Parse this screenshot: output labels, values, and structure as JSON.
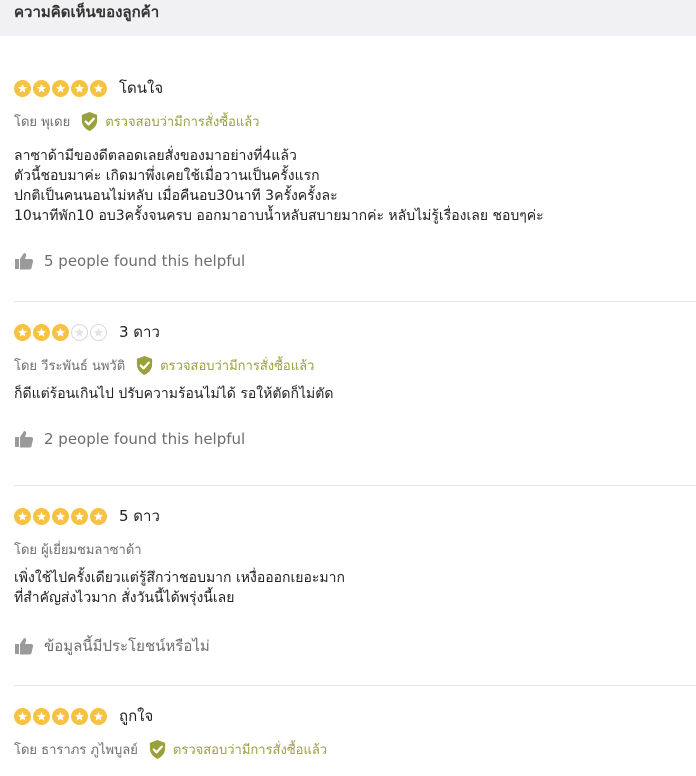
{
  "header": {
    "title": "ความคิดเห็นของลูกค้า"
  },
  "reviews": [
    {
      "stars": 5,
      "title": "โดนใจ",
      "author": "โดย พุเดย",
      "verified": "ตรวจสอบว่ามีการสั่งซื้อแล้ว",
      "body": [
        "ลาซาด้ามีของดีตลอดเลยสั่งของมาอย่างที่4แล้ว",
        "ตัวนี้ชอบมาค่ะ เกิดมาพึ่งเคยใช้เมื่อวานเป็นครั้งแรก",
        "ปกติเป็นคนนอนไม่หลับ เมื่อคืนอบ30นาที 3ครั้งครั้งละ",
        "10นาทีพัก10 อบ3ครั้งจนครบ ออกมาอาบน้ำหลับสบายมากค่ะ หลับไม่รู้เรื่องเลย ชอบๆค่ะ"
      ],
      "helpful": "5 people found this helpful"
    },
    {
      "stars": 3,
      "title": "3 ดาว",
      "author": "โดย วีระพันธ์ นพวัติ",
      "verified": "ตรวจสอบว่ามีการสั่งซื้อแล้ว",
      "body": [
        "ก็ดีแต่ร้อนเกินไป ปรับความร้อนไม่ได้ รอให้ตัดก็ไม่ตัด"
      ],
      "helpful": "2 people found this helpful"
    },
    {
      "stars": 5,
      "title": "5 ดาว",
      "author": "โดย ผู้เยี่ยมชมลาซาด้า",
      "body": [
        "เพิ่งใช้ไปครั้งเดียวแต่รู้สึกว่าชอบมาก เหงื่อออกเยอะมาก",
        "ที่สำคัญส่งไวมาก สั่งวันนี้ได้พรุ่งนี้เลย"
      ],
      "helpful": "ข้อมูลนี้มีประโยชน์หรือไม่"
    },
    {
      "stars": 5,
      "title": "ถูกใจ",
      "author": "โดย ธาราภร ภูไพบูลย์",
      "verified": "ตรวจสอบว่ามีการสั่งซื้อแล้ว"
    }
  ],
  "colors": {
    "star": "#f5c242",
    "verified": "#9aa03c",
    "muted": "#6d6d6d"
  },
  "icons": {
    "star": "star-icon",
    "verified": "shield-check-icon",
    "helpful": "thumbs-up-icon"
  }
}
